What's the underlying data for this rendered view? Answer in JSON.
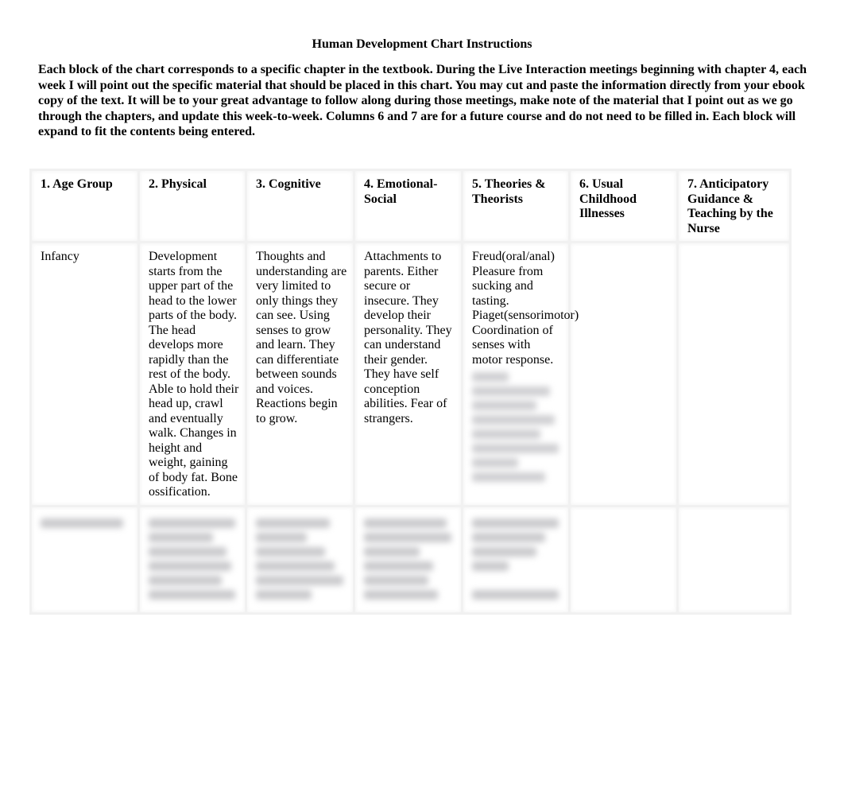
{
  "document": {
    "title": "Human Development Chart Instructions",
    "intro": "Each block of the chart corresponds to a specific chapter in the textbook. During the Live Interaction meetings beginning with chapter 4, each week I will point out the specific material that should be placed in this chart. You may cut and paste the information directly from your ebook copy of the text. It will be to your great advantage to follow along during those meetings, make note of the material that I point out as we go through the chapters, and update this week-to-week. Columns 6 and 7 are for a future course and do not need to be filled in. Each block will expand to fit the contents being entered."
  },
  "table": {
    "headers": [
      "1. Age Group",
      "2. Physical",
      "3. Cognitive",
      "4. Emotional-Social",
      "5. Theories & Theorists",
      "6. Usual Childhood Illnesses",
      "7. Anticipatory Guidance & Teaching by the Nurse"
    ],
    "rows": [
      {
        "age_group": "Infancy",
        "physical": "Development starts from the upper part of the head to the lower parts of the body. The head develops more rapidly than the rest of the body. Able to hold their head up, crawl and eventually walk. Changes in height and weight, gaining of body fat. Bone ossification.",
        "cognitive": "Thoughts and understanding are very limited to only things they can see. Using senses to grow and learn. They can differentiate between sounds and voices. Reactions begin to grow.",
        "emotional_social": "Attachments to parents. Either secure or insecure. They develop their personality. They can understand their gender. They have self conception abilities. Fear of strangers.",
        "theories": "Freud(oral/anal) Pleasure from sucking and tasting. Piaget(sensorimotor) Coordination of senses with motor response.",
        "theories_more": "[blurred content]",
        "illnesses": "",
        "guidance": ""
      },
      {
        "age_group": "[blurred content]",
        "physical": "[blurred content]",
        "cognitive": "[blurred content]",
        "emotional_social": "[blurred content]",
        "theories": "[blurred content]",
        "illnesses": "",
        "guidance": ""
      }
    ]
  }
}
